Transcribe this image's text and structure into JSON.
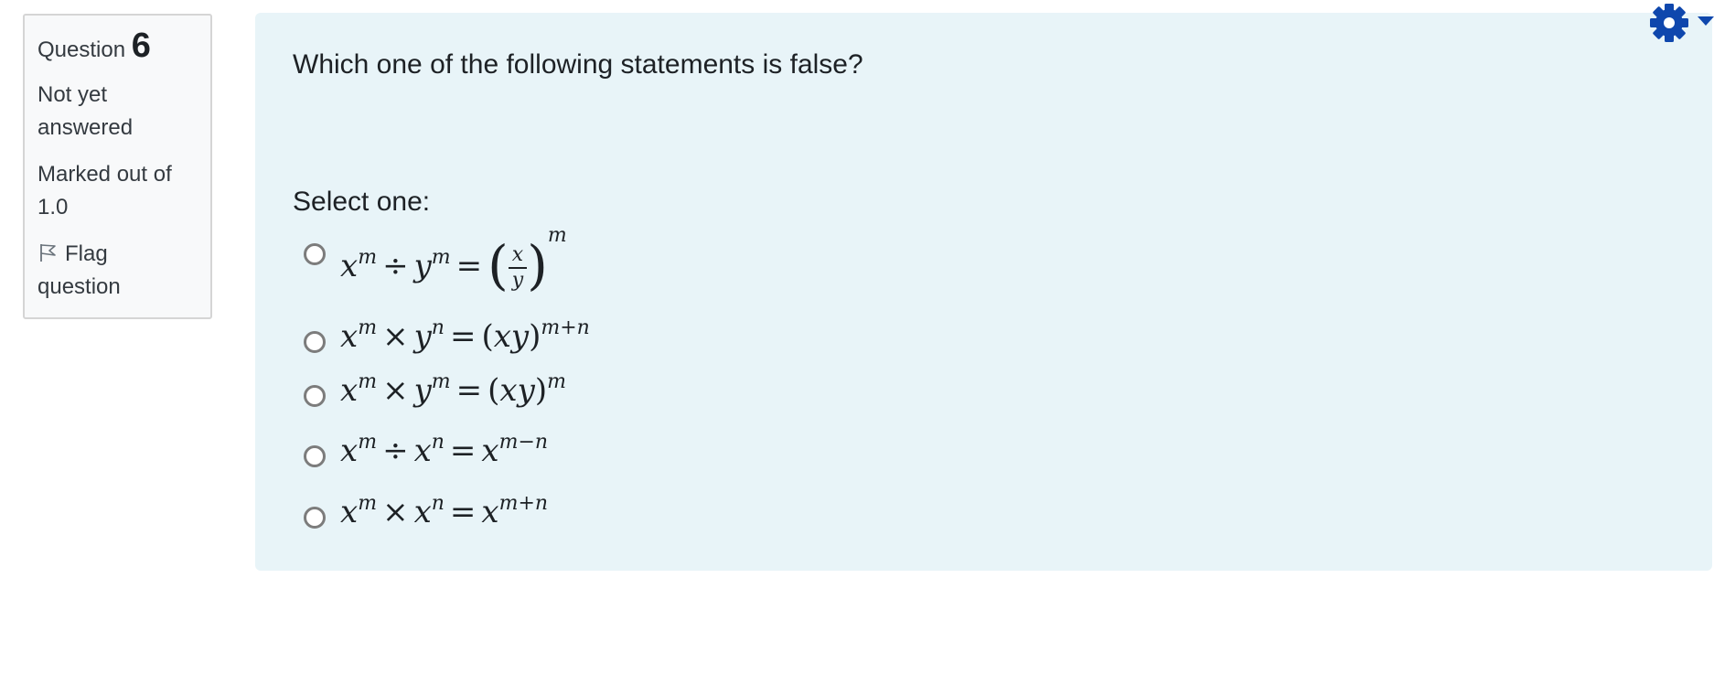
{
  "info": {
    "question_label": "Question",
    "question_number": "6",
    "state_line1": "Not yet",
    "state_line2": "answered",
    "grade_line1": "Marked out of",
    "grade_line2": "1.0",
    "flag_line1": "Flag",
    "flag_line2": "question",
    "flag_icon": "flag-icon"
  },
  "question": {
    "text": "Which one of the following statements is false?",
    "prompt": "Select one:"
  },
  "options": [
    {
      "label": "x^m ÷ y^m = (x/y)^m",
      "selected": false
    },
    {
      "label": "x^m × y^n = (xy)^(m+n)",
      "selected": false
    },
    {
      "label": "x^m × y^m = (xy)^m",
      "selected": false
    },
    {
      "label": "x^m ÷ x^n = x^(m−n)",
      "selected": false
    },
    {
      "label": "x^m × x^n = x^(m+n)",
      "selected": false
    }
  ],
  "actions": {
    "icon": "gear-icon"
  },
  "colors": {
    "content_bg": "#e8f4f8",
    "info_bg": "#f8f9fa",
    "accent": "#0f47ad"
  }
}
